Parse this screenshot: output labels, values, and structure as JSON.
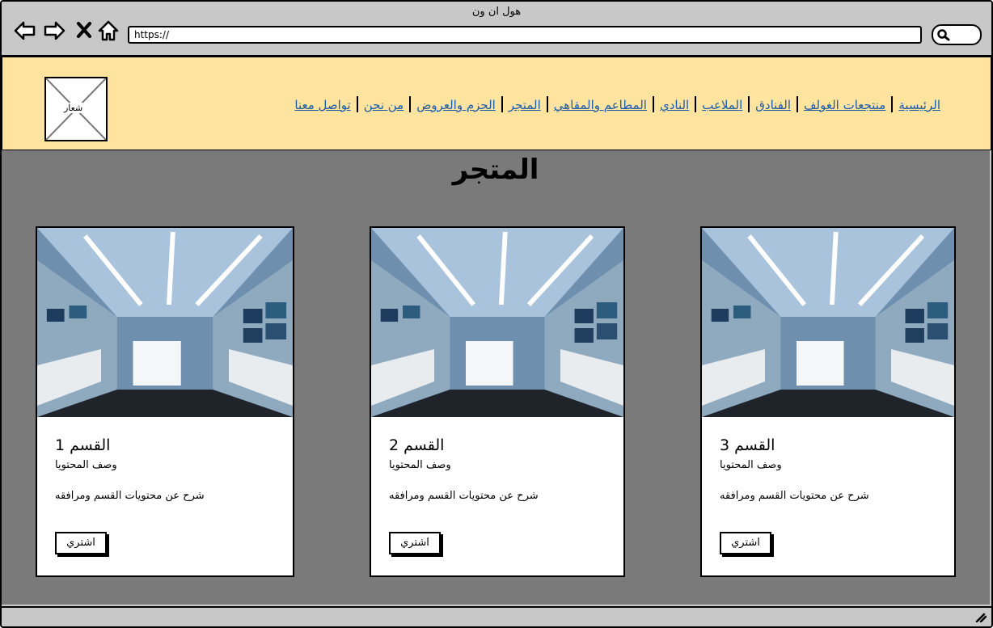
{
  "window": {
    "title": "هول ان ون"
  },
  "browser": {
    "url": "https://"
  },
  "header": {
    "logo_label": "شعار",
    "menu": [
      {
        "label": "الرئيسية"
      },
      {
        "label": "منتجعات الغولف"
      },
      {
        "label": "الفنادق"
      },
      {
        "label": "الملاعب"
      },
      {
        "label": "النادي"
      },
      {
        "label": "المطاعم والمقاهي"
      },
      {
        "label": "المتجر"
      },
      {
        "label": "الحزم والعروض"
      },
      {
        "label": "من نحن"
      },
      {
        "label": "تواصل معنا"
      }
    ]
  },
  "main": {
    "title": "المتجر",
    "cards": [
      {
        "title": "القسم 1",
        "subtitle": "وصف المحتويا",
        "description": "شرح عن محتويات القسم ومرافقه",
        "button": "اشتري"
      },
      {
        "title": "القسم 2",
        "subtitle": "وصف المحتويا",
        "description": "شرح عن محتويات القسم ومرافقه",
        "button": "اشتري"
      },
      {
        "title": "القسم 3",
        "subtitle": "وصف المحتويا",
        "description": "شرح عن محتويات القسم ومرافقه",
        "button": "اشتري"
      }
    ]
  },
  "colors": {
    "header_bg": "#ffe4a0",
    "main_bg": "#7a7a7a",
    "chrome_bg": "#c8c8c8",
    "link": "#1c5aa8"
  },
  "icons": [
    "back-arrow-icon",
    "forward-arrow-icon",
    "close-icon",
    "home-icon",
    "search-icon",
    "resize-grip-icon"
  ]
}
